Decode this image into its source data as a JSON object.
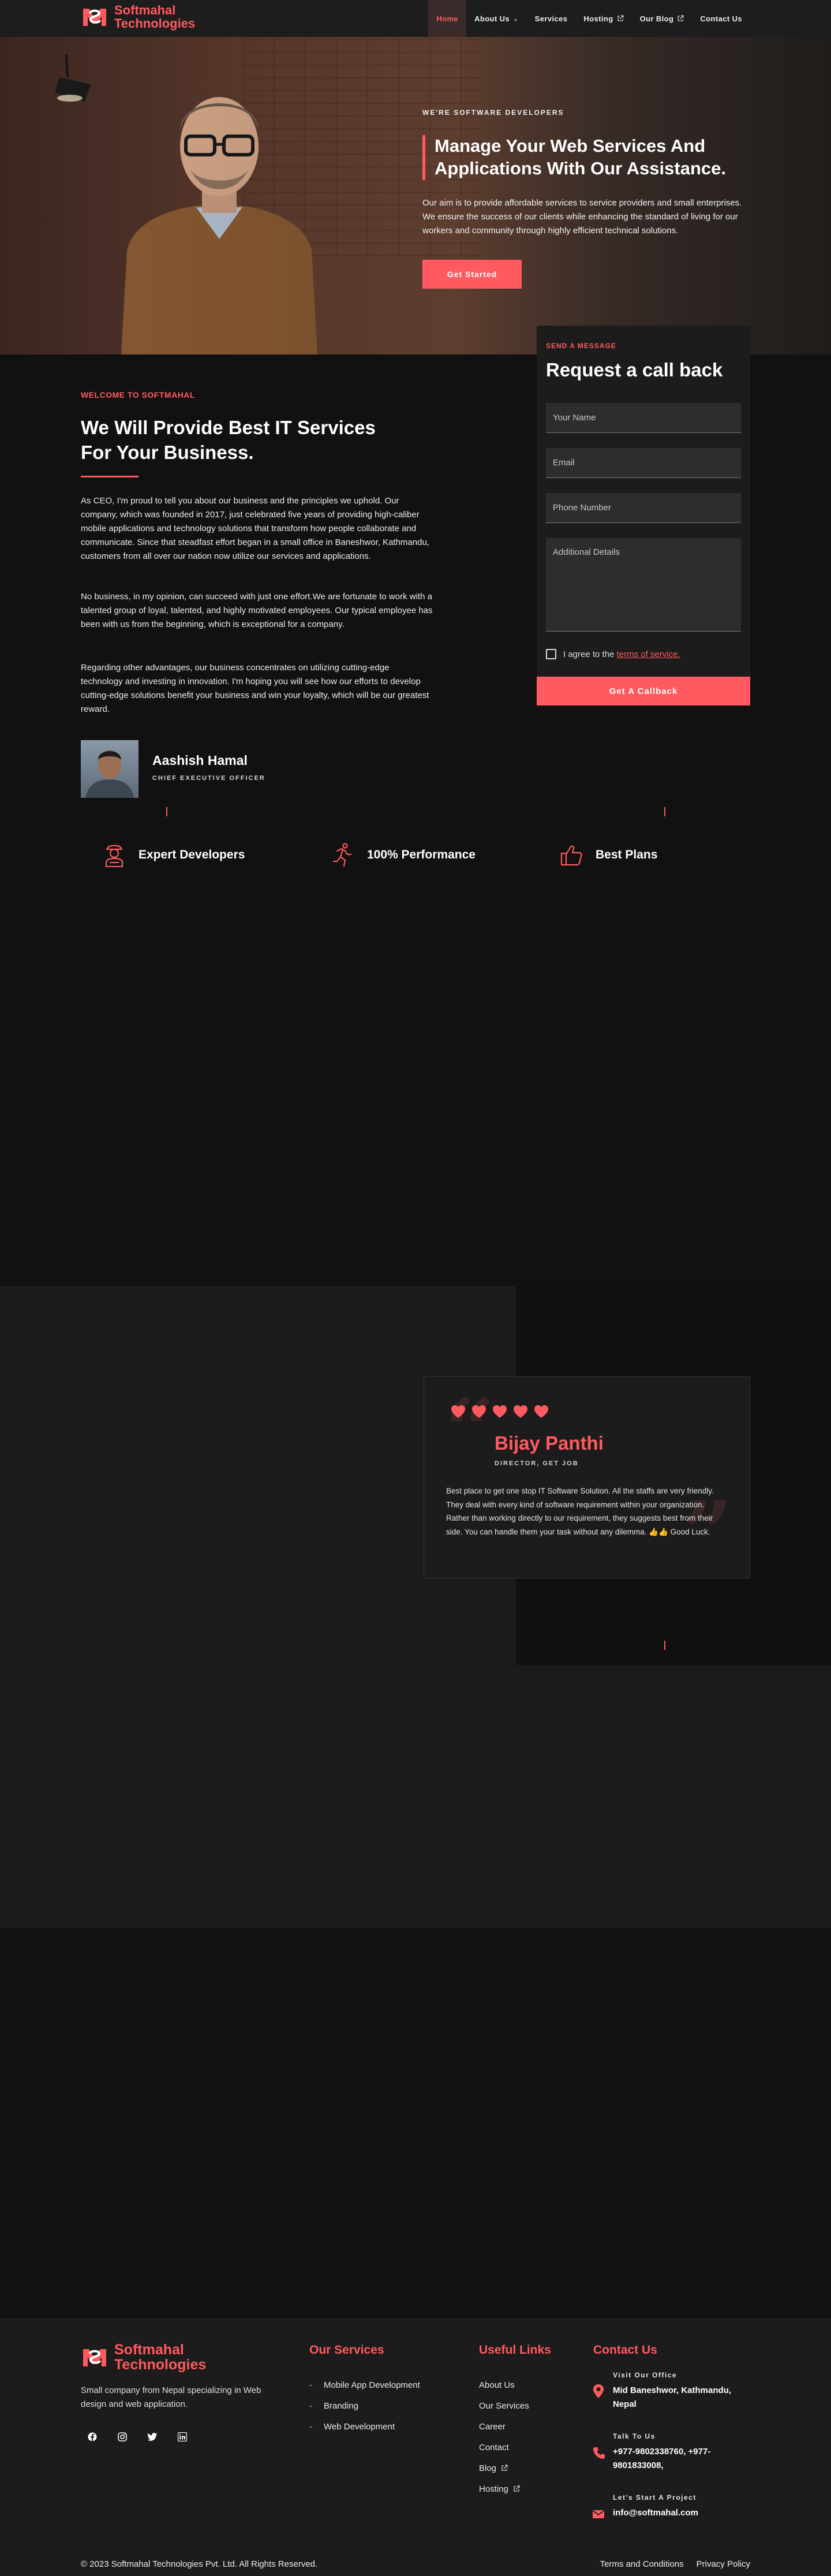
{
  "brand": {
    "line1": "Softmahal",
    "line2": "Technologies",
    "accent": "#ff5a5f"
  },
  "nav": {
    "items": [
      {
        "label": "Home",
        "active": true
      },
      {
        "label": "About Us",
        "icon": "chevron-down-icon"
      },
      {
        "label": "Services"
      },
      {
        "label": "Hosting",
        "icon": "external-link-icon"
      },
      {
        "label": "Our Blog",
        "icon": "external-link-icon"
      },
      {
        "label": "Contact Us"
      }
    ]
  },
  "hero": {
    "subtitle": "WE'RE SOFTWARE DEVELOPERS",
    "title": "Manage Your Web Services And Applications With Our Assistance.",
    "text": "Our aim is to provide affordable services to service providers and small enterprises. We ensure the success of our clients while enhancing the standard of living for our workers and community through highly efficient technical solutions.",
    "button": "Get Started"
  },
  "welcome": {
    "subtitle": "WELCOME TO SOFTMAHAL",
    "title": "We Will Provide Best IT Services For Your Business.",
    "paragraphs": [
      "As CEO, I'm proud to tell you about our business and the principles we uphold. Our company, which was founded in 2017, just celebrated five years of providing high-caliber mobile applications and technology solutions that transform how people collaborate and communicate. Since that steadfast effort began in a small office in Baneshwor, Kathmandu, customers from all over our nation now utilize our services and applications.",
      "No business, in my opinion, can succeed with just one effort.We are fortunate to work with a talented group of loyal, talented, and highly motivated employees. Our typical employee has been with us from the beginning, which is exceptional for a company.",
      "Regarding other advantages, our business concentrates on utilizing cutting-edge technology and investing in innovation. I'm hoping you will see how our efforts to develop cutting-edge solutions benefit your business and win your loyalty, which will be our greatest reward."
    ],
    "ceo_name": "Aashish Hamal",
    "ceo_role": "CHIEF EXECUTIVE OFFICER"
  },
  "callback": {
    "subtitle": "SEND A MESSAGE",
    "title": "Request a call back",
    "name_placeholder": "Your Name",
    "email_placeholder": "Email",
    "phone_placeholder": "Phone Number",
    "details_placeholder": "Additional Details",
    "agree_prefix": "I agree to the",
    "agree_link": "terms of service.",
    "button": "Get A Callback"
  },
  "features": [
    {
      "label": "Expert Developers",
      "icon": "developer-icon"
    },
    {
      "label": "100% Performance",
      "icon": "running-person-icon"
    },
    {
      "label": "Best Plans",
      "icon": "thumbs-up-icon"
    }
  ],
  "testimonial": {
    "rating": 5,
    "name": "Bijay Panthi",
    "role": "DIRECTOR, GET JOB",
    "text": "Best place to get one stop IT Software Solution. All the staffs are very friendly. They deal with every kind of software requirement within your organization. Rather than working directly to our requirement, they suggests best from their side. You can handle them your task without any dilemma. 👍👍 Good Luck."
  },
  "footer": {
    "description": "Small company from Nepal specializing in Web design and web application.",
    "socials": [
      "facebook-icon",
      "instagram-icon",
      "twitter-icon",
      "linkedin-icon"
    ],
    "services_title": "Our Services",
    "services": [
      "Mobile App Development",
      "Branding",
      "Web Development"
    ],
    "links_title": "Useful Links",
    "links": [
      {
        "label": "About Us"
      },
      {
        "label": "Our Services"
      },
      {
        "label": "Career"
      },
      {
        "label": "Contact"
      },
      {
        "label": "Blog",
        "icon": "external-link-icon"
      },
      {
        "label": "Hosting",
        "icon": "external-link-icon"
      }
    ],
    "contact_title": "Contact Us",
    "contact": [
      {
        "sub": "Visit Our Office",
        "value": "Mid Baneshwor, Kathmandu, Nepal",
        "icon": "location-pin-icon"
      },
      {
        "sub": "Talk To Us",
        "value": "+977-9802338760, +977-9801833008,",
        "icon": "phone-icon"
      },
      {
        "sub": "Let's Start A Project",
        "value": "info@softmahal.com",
        "icon": "mail-icon"
      }
    ],
    "copyright": "© 2023 Softmahal Technologies Pvt. Ltd. All Rights Reserved.",
    "terms": "Terms and Conditions",
    "privacy": "Privacy Policy"
  }
}
